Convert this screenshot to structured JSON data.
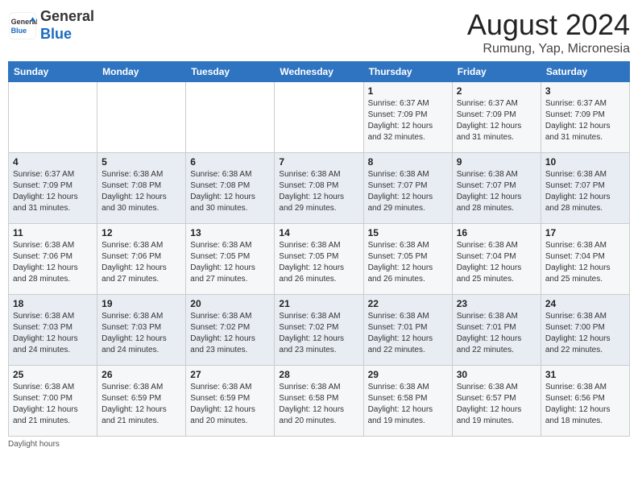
{
  "header": {
    "logo_general": "General",
    "logo_blue": "Blue",
    "month_year": "August 2024",
    "location": "Rumung, Yap, Micronesia"
  },
  "days_of_week": [
    "Sunday",
    "Monday",
    "Tuesday",
    "Wednesday",
    "Thursday",
    "Friday",
    "Saturday"
  ],
  "weeks": [
    [
      {
        "num": "",
        "detail": ""
      },
      {
        "num": "",
        "detail": ""
      },
      {
        "num": "",
        "detail": ""
      },
      {
        "num": "",
        "detail": ""
      },
      {
        "num": "1",
        "detail": "Sunrise: 6:37 AM\nSunset: 7:09 PM\nDaylight: 12 hours and 32 minutes."
      },
      {
        "num": "2",
        "detail": "Sunrise: 6:37 AM\nSunset: 7:09 PM\nDaylight: 12 hours and 31 minutes."
      },
      {
        "num": "3",
        "detail": "Sunrise: 6:37 AM\nSunset: 7:09 PM\nDaylight: 12 hours and 31 minutes."
      }
    ],
    [
      {
        "num": "4",
        "detail": "Sunrise: 6:37 AM\nSunset: 7:09 PM\nDaylight: 12 hours and 31 minutes."
      },
      {
        "num": "5",
        "detail": "Sunrise: 6:38 AM\nSunset: 7:08 PM\nDaylight: 12 hours and 30 minutes."
      },
      {
        "num": "6",
        "detail": "Sunrise: 6:38 AM\nSunset: 7:08 PM\nDaylight: 12 hours and 30 minutes."
      },
      {
        "num": "7",
        "detail": "Sunrise: 6:38 AM\nSunset: 7:08 PM\nDaylight: 12 hours and 29 minutes."
      },
      {
        "num": "8",
        "detail": "Sunrise: 6:38 AM\nSunset: 7:07 PM\nDaylight: 12 hours and 29 minutes."
      },
      {
        "num": "9",
        "detail": "Sunrise: 6:38 AM\nSunset: 7:07 PM\nDaylight: 12 hours and 28 minutes."
      },
      {
        "num": "10",
        "detail": "Sunrise: 6:38 AM\nSunset: 7:07 PM\nDaylight: 12 hours and 28 minutes."
      }
    ],
    [
      {
        "num": "11",
        "detail": "Sunrise: 6:38 AM\nSunset: 7:06 PM\nDaylight: 12 hours and 28 minutes."
      },
      {
        "num": "12",
        "detail": "Sunrise: 6:38 AM\nSunset: 7:06 PM\nDaylight: 12 hours and 27 minutes."
      },
      {
        "num": "13",
        "detail": "Sunrise: 6:38 AM\nSunset: 7:05 PM\nDaylight: 12 hours and 27 minutes."
      },
      {
        "num": "14",
        "detail": "Sunrise: 6:38 AM\nSunset: 7:05 PM\nDaylight: 12 hours and 26 minutes."
      },
      {
        "num": "15",
        "detail": "Sunrise: 6:38 AM\nSunset: 7:05 PM\nDaylight: 12 hours and 26 minutes."
      },
      {
        "num": "16",
        "detail": "Sunrise: 6:38 AM\nSunset: 7:04 PM\nDaylight: 12 hours and 25 minutes."
      },
      {
        "num": "17",
        "detail": "Sunrise: 6:38 AM\nSunset: 7:04 PM\nDaylight: 12 hours and 25 minutes."
      }
    ],
    [
      {
        "num": "18",
        "detail": "Sunrise: 6:38 AM\nSunset: 7:03 PM\nDaylight: 12 hours and 24 minutes."
      },
      {
        "num": "19",
        "detail": "Sunrise: 6:38 AM\nSunset: 7:03 PM\nDaylight: 12 hours and 24 minutes."
      },
      {
        "num": "20",
        "detail": "Sunrise: 6:38 AM\nSunset: 7:02 PM\nDaylight: 12 hours and 23 minutes."
      },
      {
        "num": "21",
        "detail": "Sunrise: 6:38 AM\nSunset: 7:02 PM\nDaylight: 12 hours and 23 minutes."
      },
      {
        "num": "22",
        "detail": "Sunrise: 6:38 AM\nSunset: 7:01 PM\nDaylight: 12 hours and 22 minutes."
      },
      {
        "num": "23",
        "detail": "Sunrise: 6:38 AM\nSunset: 7:01 PM\nDaylight: 12 hours and 22 minutes."
      },
      {
        "num": "24",
        "detail": "Sunrise: 6:38 AM\nSunset: 7:00 PM\nDaylight: 12 hours and 22 minutes."
      }
    ],
    [
      {
        "num": "25",
        "detail": "Sunrise: 6:38 AM\nSunset: 7:00 PM\nDaylight: 12 hours and 21 minutes."
      },
      {
        "num": "26",
        "detail": "Sunrise: 6:38 AM\nSunset: 6:59 PM\nDaylight: 12 hours and 21 minutes."
      },
      {
        "num": "27",
        "detail": "Sunrise: 6:38 AM\nSunset: 6:59 PM\nDaylight: 12 hours and 20 minutes."
      },
      {
        "num": "28",
        "detail": "Sunrise: 6:38 AM\nSunset: 6:58 PM\nDaylight: 12 hours and 20 minutes."
      },
      {
        "num": "29",
        "detail": "Sunrise: 6:38 AM\nSunset: 6:58 PM\nDaylight: 12 hours and 19 minutes."
      },
      {
        "num": "30",
        "detail": "Sunrise: 6:38 AM\nSunset: 6:57 PM\nDaylight: 12 hours and 19 minutes."
      },
      {
        "num": "31",
        "detail": "Sunrise: 6:38 AM\nSunset: 6:56 PM\nDaylight: 12 hours and 18 minutes."
      }
    ]
  ],
  "footer": {
    "daylight_label": "Daylight hours"
  }
}
